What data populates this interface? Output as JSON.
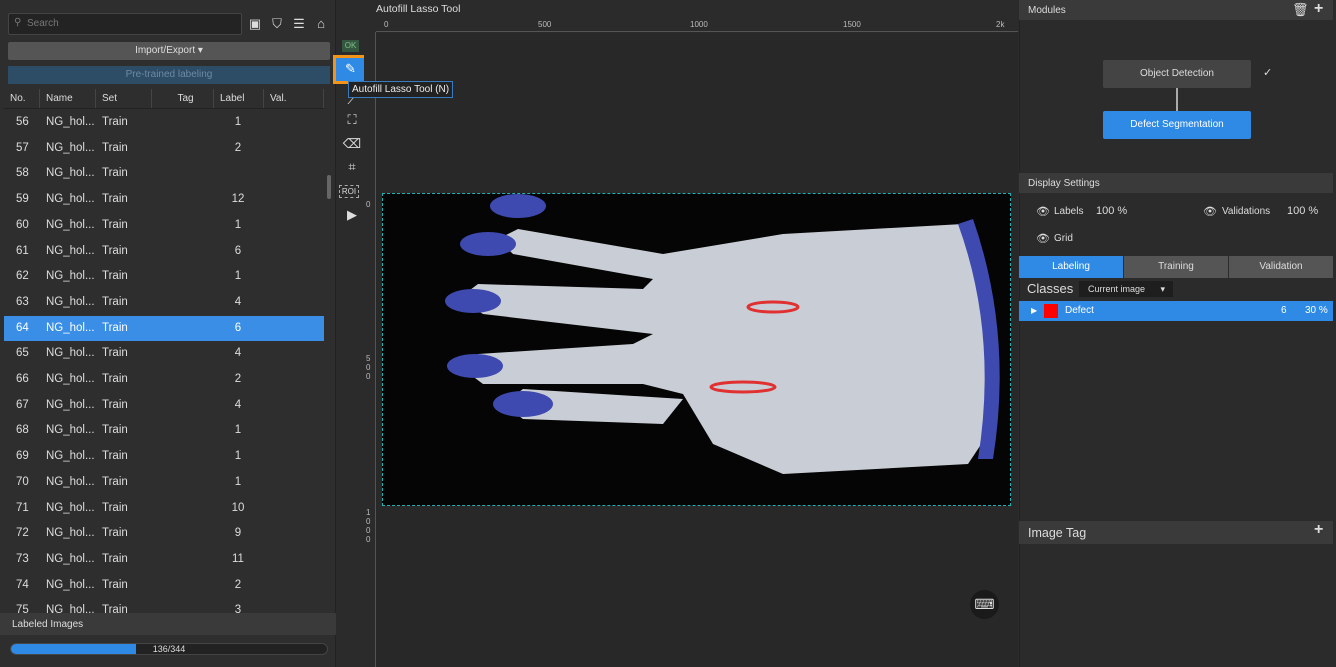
{
  "left": {
    "search_placeholder": "Search",
    "import_export": "Import/Export",
    "pretrained": "Pre-trained labeling",
    "columns": [
      "No.",
      "Name",
      "Set",
      "Tag",
      "Label",
      "Val."
    ],
    "rows": [
      {
        "no": "56",
        "name": "NG_hol...",
        "set": "Train",
        "label": "1"
      },
      {
        "no": "57",
        "name": "NG_hol...",
        "set": "Train",
        "label": "2"
      },
      {
        "no": "58",
        "name": "NG_hol...",
        "set": "Train",
        "label": ""
      },
      {
        "no": "59",
        "name": "NG_hol...",
        "set": "Train",
        "label": "12"
      },
      {
        "no": "60",
        "name": "NG_hol...",
        "set": "Train",
        "label": "1"
      },
      {
        "no": "61",
        "name": "NG_hol...",
        "set": "Train",
        "label": "6"
      },
      {
        "no": "62",
        "name": "NG_hol...",
        "set": "Train",
        "label": "1"
      },
      {
        "no": "63",
        "name": "NG_hol...",
        "set": "Train",
        "label": "4"
      },
      {
        "no": "64",
        "name": "NG_hol...",
        "set": "Train",
        "label": "6",
        "selected": true
      },
      {
        "no": "65",
        "name": "NG_hol...",
        "set": "Train",
        "label": "4"
      },
      {
        "no": "66",
        "name": "NG_hol...",
        "set": "Train",
        "label": "2"
      },
      {
        "no": "67",
        "name": "NG_hol...",
        "set": "Train",
        "label": "4"
      },
      {
        "no": "68",
        "name": "NG_hol...",
        "set": "Train",
        "label": "1"
      },
      {
        "no": "69",
        "name": "NG_hol...",
        "set": "Train",
        "label": "1"
      },
      {
        "no": "70",
        "name": "NG_hol...",
        "set": "Train",
        "label": "1"
      },
      {
        "no": "71",
        "name": "NG_hol...",
        "set": "Train",
        "label": "10"
      },
      {
        "no": "72",
        "name": "NG_hol...",
        "set": "Train",
        "label": "9"
      },
      {
        "no": "73",
        "name": "NG_hol...",
        "set": "Train",
        "label": "11"
      },
      {
        "no": "74",
        "name": "NG_hol...",
        "set": "Train",
        "label": "2"
      },
      {
        "no": "75",
        "name": "NG_hol...",
        "set": "Train",
        "label": "3"
      }
    ],
    "labeled_images": "Labeled Images",
    "progress_text": "136/344",
    "progress_value": 0.395
  },
  "tools": {
    "ok": "OK",
    "tooltip": "Autofill Lasso Tool (N)",
    "roi": "ROI"
  },
  "canvas": {
    "title": "Autofill Lasso Tool",
    "ruler_top": [
      "0",
      "500",
      "1000",
      "1500",
      "2k"
    ],
    "ruler_left": [
      "0",
      "500",
      "1000"
    ]
  },
  "right": {
    "modules": "Modules",
    "module_items": [
      "Object Detection",
      "Defect Segmentation"
    ],
    "display_settings": "Display Settings",
    "labels": "Labels",
    "labels_pct": "100 %",
    "validations": "Validations",
    "validations_pct": "100 %",
    "grid": "Grid",
    "tabs": [
      "Labeling",
      "Training",
      "Validation"
    ],
    "classes": "Classes",
    "class_filter": "Current image",
    "class_items": [
      {
        "name": "Defect",
        "count": "6",
        "pct": "30 %",
        "color": "#ff0000"
      }
    ],
    "image_tag": "Image Tag"
  },
  "colors": {
    "accent": "#2f8ae6",
    "highlight": "#f39418"
  }
}
